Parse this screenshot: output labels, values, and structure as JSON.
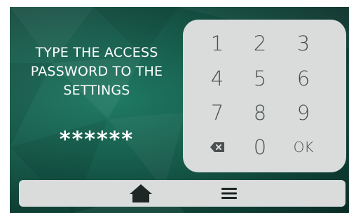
{
  "prompt": {
    "line1": "TYPE THE ACCESS",
    "line2": "PASSWORD TO THE",
    "line3": "SETTINGS"
  },
  "password_display": "******",
  "keypad": {
    "k1": "1",
    "k2": "2",
    "k3": "3",
    "k4": "4",
    "k5": "5",
    "k6": "6",
    "k7": "7",
    "k8": "8",
    "k9": "9",
    "backspace_icon": "backspace-icon",
    "k0": "0",
    "ok": "OK"
  },
  "navbar": {
    "home_icon": "home-icon",
    "menu_icon": "menu-icon"
  },
  "colors": {
    "background": "#155848",
    "panel": "#d9dcdb",
    "key_text": "#4a4f4f",
    "text": "#ffffff"
  }
}
